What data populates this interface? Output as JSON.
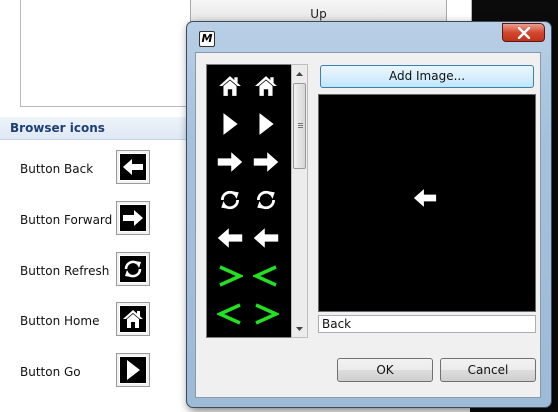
{
  "background": {
    "up_button_label": "Up",
    "section_header": "Browser icons",
    "icon_rows": [
      {
        "label": "Button Back",
        "icon": "arrow-left-icon"
      },
      {
        "label": "Button Forward",
        "icon": "arrow-right-icon"
      },
      {
        "label": "Button Refresh",
        "icon": "refresh-icon"
      },
      {
        "label": "Button Home",
        "icon": "home-icon"
      },
      {
        "label": "Button Go",
        "icon": "play-icon"
      }
    ]
  },
  "dialog": {
    "title_icon_text": "M",
    "close_icon": "close-icon",
    "icon_list": [
      [
        "home-icon",
        "home-icon"
      ],
      [
        "play-icon",
        "play-icon"
      ],
      [
        "arrow-right-icon",
        "arrow-right-icon"
      ],
      [
        "refresh-icon",
        "refresh-icon"
      ],
      [
        "arrow-left-icon",
        "arrow-left-icon"
      ],
      [
        "green-chevron-right-icon",
        "green-chevron-left-icon"
      ],
      [
        "green-chevron-left-icon",
        "green-chevron-right-icon"
      ]
    ],
    "add_image_label": "Add Image...",
    "preview_icon": "arrow-left-icon",
    "selected_name": "Back",
    "ok_label": "OK",
    "cancel_label": "Cancel"
  },
  "colors": {
    "icon_foreground": "#ffffff",
    "icon_background": "#000000",
    "chevron_green": "#22e022",
    "section_header_text": "#1e3e74",
    "close_button_red": "#c7381f"
  }
}
